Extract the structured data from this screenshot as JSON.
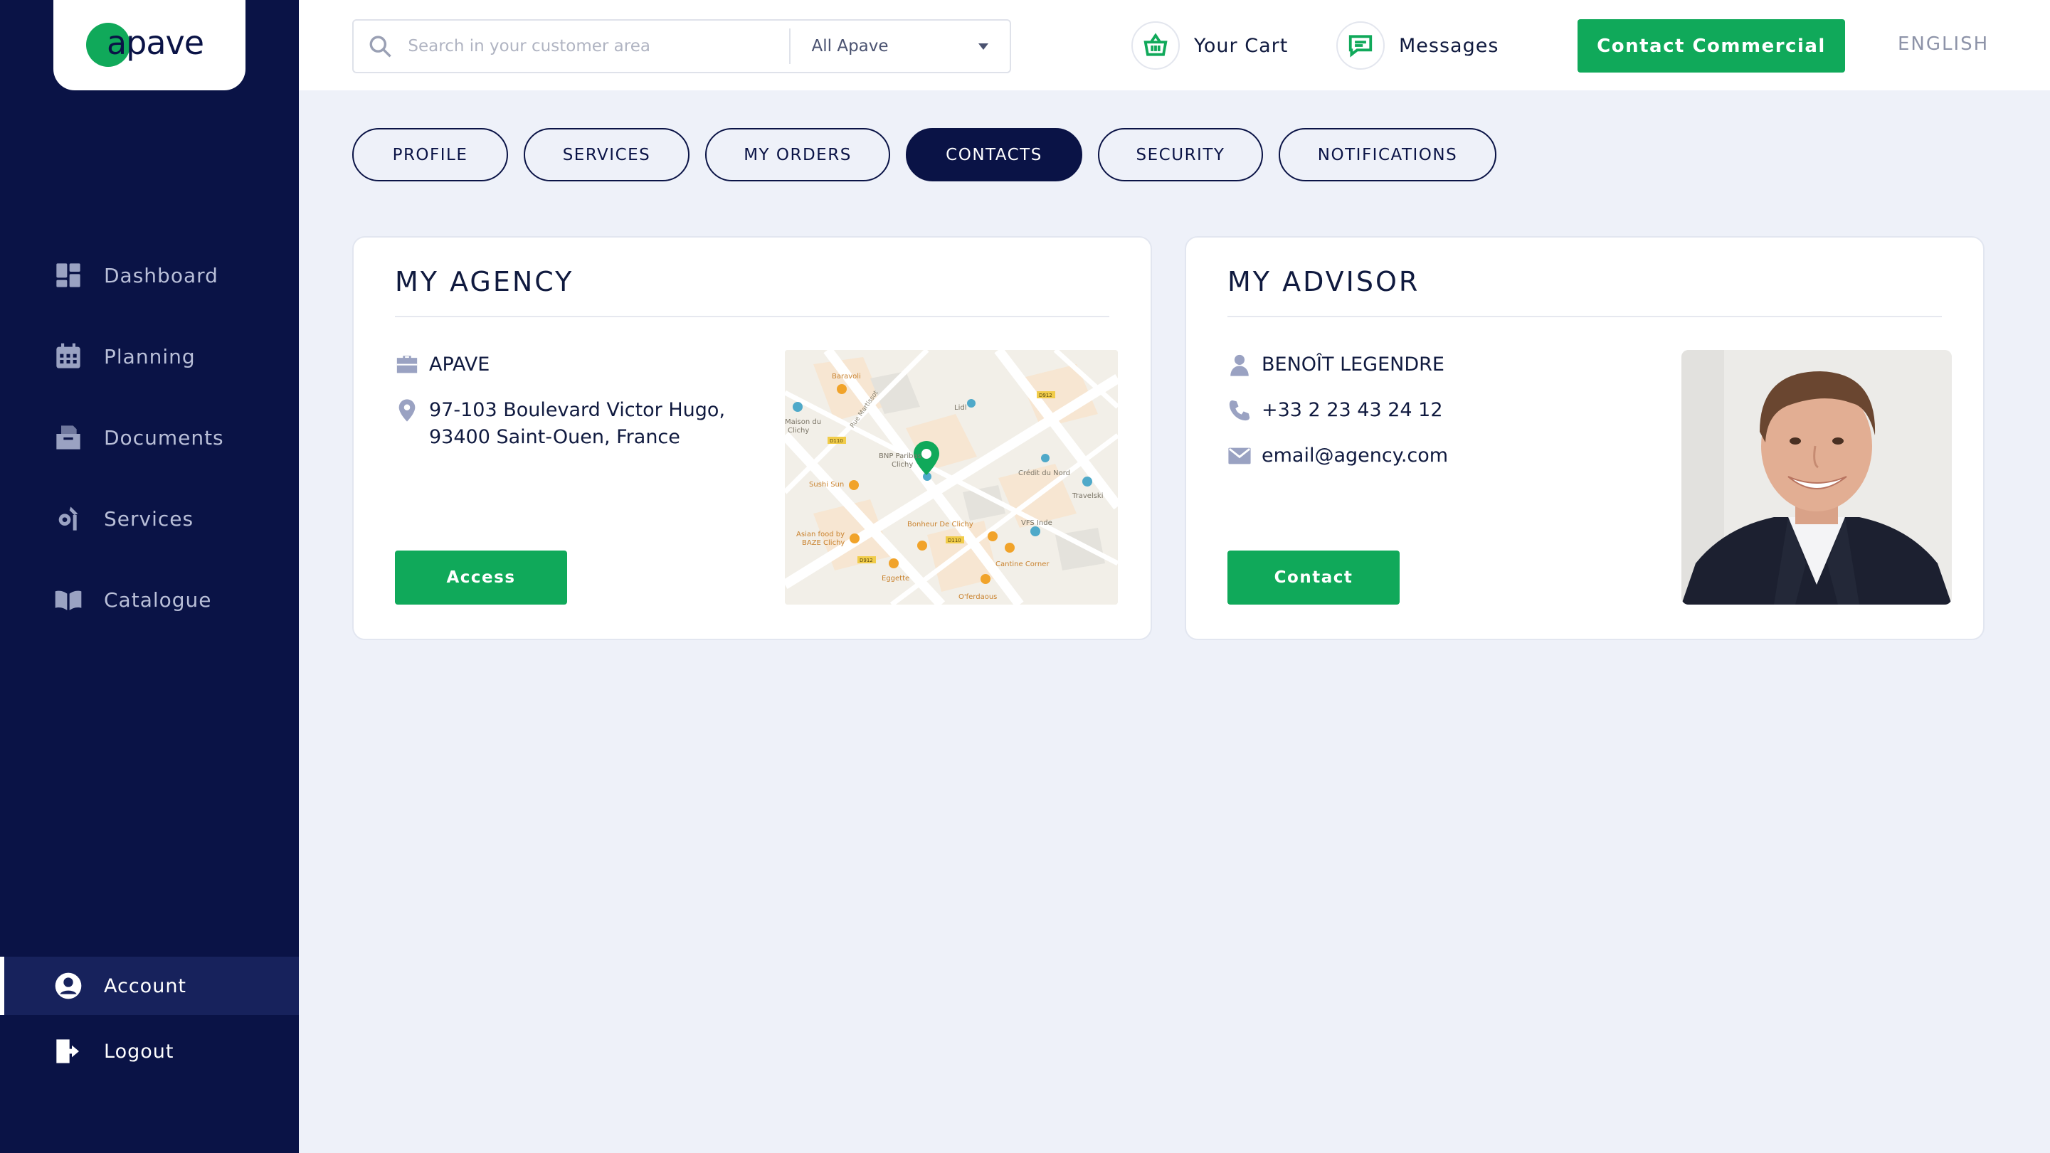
{
  "brand": {
    "logo_text": "apave",
    "accent": "#10a95a",
    "navy": "#0a1346"
  },
  "sidebar": {
    "items": [
      {
        "label": "Dashboard",
        "icon": "dashboard-icon"
      },
      {
        "label": "Planning",
        "icon": "calendar-icon"
      },
      {
        "label": "Documents",
        "icon": "documents-icon"
      },
      {
        "label": "Services",
        "icon": "services-icon"
      },
      {
        "label": "Catalogue",
        "icon": "catalogue-icon"
      }
    ],
    "account_label": "Account",
    "logout_label": "Logout"
  },
  "topbar": {
    "search_placeholder": "Search in your customer area",
    "scope_selected": "All Apave",
    "cart_label": "Your Cart",
    "messages_label": "Messages",
    "contact_commercial_label": "Contact Commercial",
    "language": "ENGLISH"
  },
  "tabs": [
    {
      "label": "PROFILE",
      "active": false
    },
    {
      "label": "SERVICES",
      "active": false
    },
    {
      "label": "MY ORDERS",
      "active": false
    },
    {
      "label": "CONTACTS",
      "active": true
    },
    {
      "label": "SECURITY",
      "active": false
    },
    {
      "label": "NOTIFICATIONS",
      "active": false
    }
  ],
  "agency": {
    "title": "MY AGENCY",
    "name": "APAVE",
    "address_line1": "97-103 Boulevard Victor Hugo,",
    "address_line2": "93400 Saint-Ouen, France",
    "button_label": "Access",
    "map_labels": {
      "baravoli": "Baravoli",
      "lidl": "Lidl",
      "bnp": "BNP Paribas",
      "clichy": "Clichy",
      "maison": "Maison du",
      "maison2": "Clichy",
      "credit": "Crédit du Nord",
      "travelski": "Travelski",
      "sushi": "Sushi Sun",
      "bonheur": "Bonheur De Clichy",
      "vfs": "VFS Inde",
      "asian": "Asian food by",
      "asian2": "BAZE Clichy",
      "cantine": "Cantine Corner",
      "eggette": "Eggette",
      "oferdaous": "O'ferdaous",
      "road1": "D912",
      "road2": "D110",
      "road3": "D912",
      "road4": "D110",
      "street1": "Rue Martissot"
    }
  },
  "advisor": {
    "title": "MY ADVISOR",
    "name": "BENOÎT LEGENDRE",
    "phone": "+33 2 23 43 24 12",
    "email": "email@agency.com",
    "button_label": "Contact"
  }
}
